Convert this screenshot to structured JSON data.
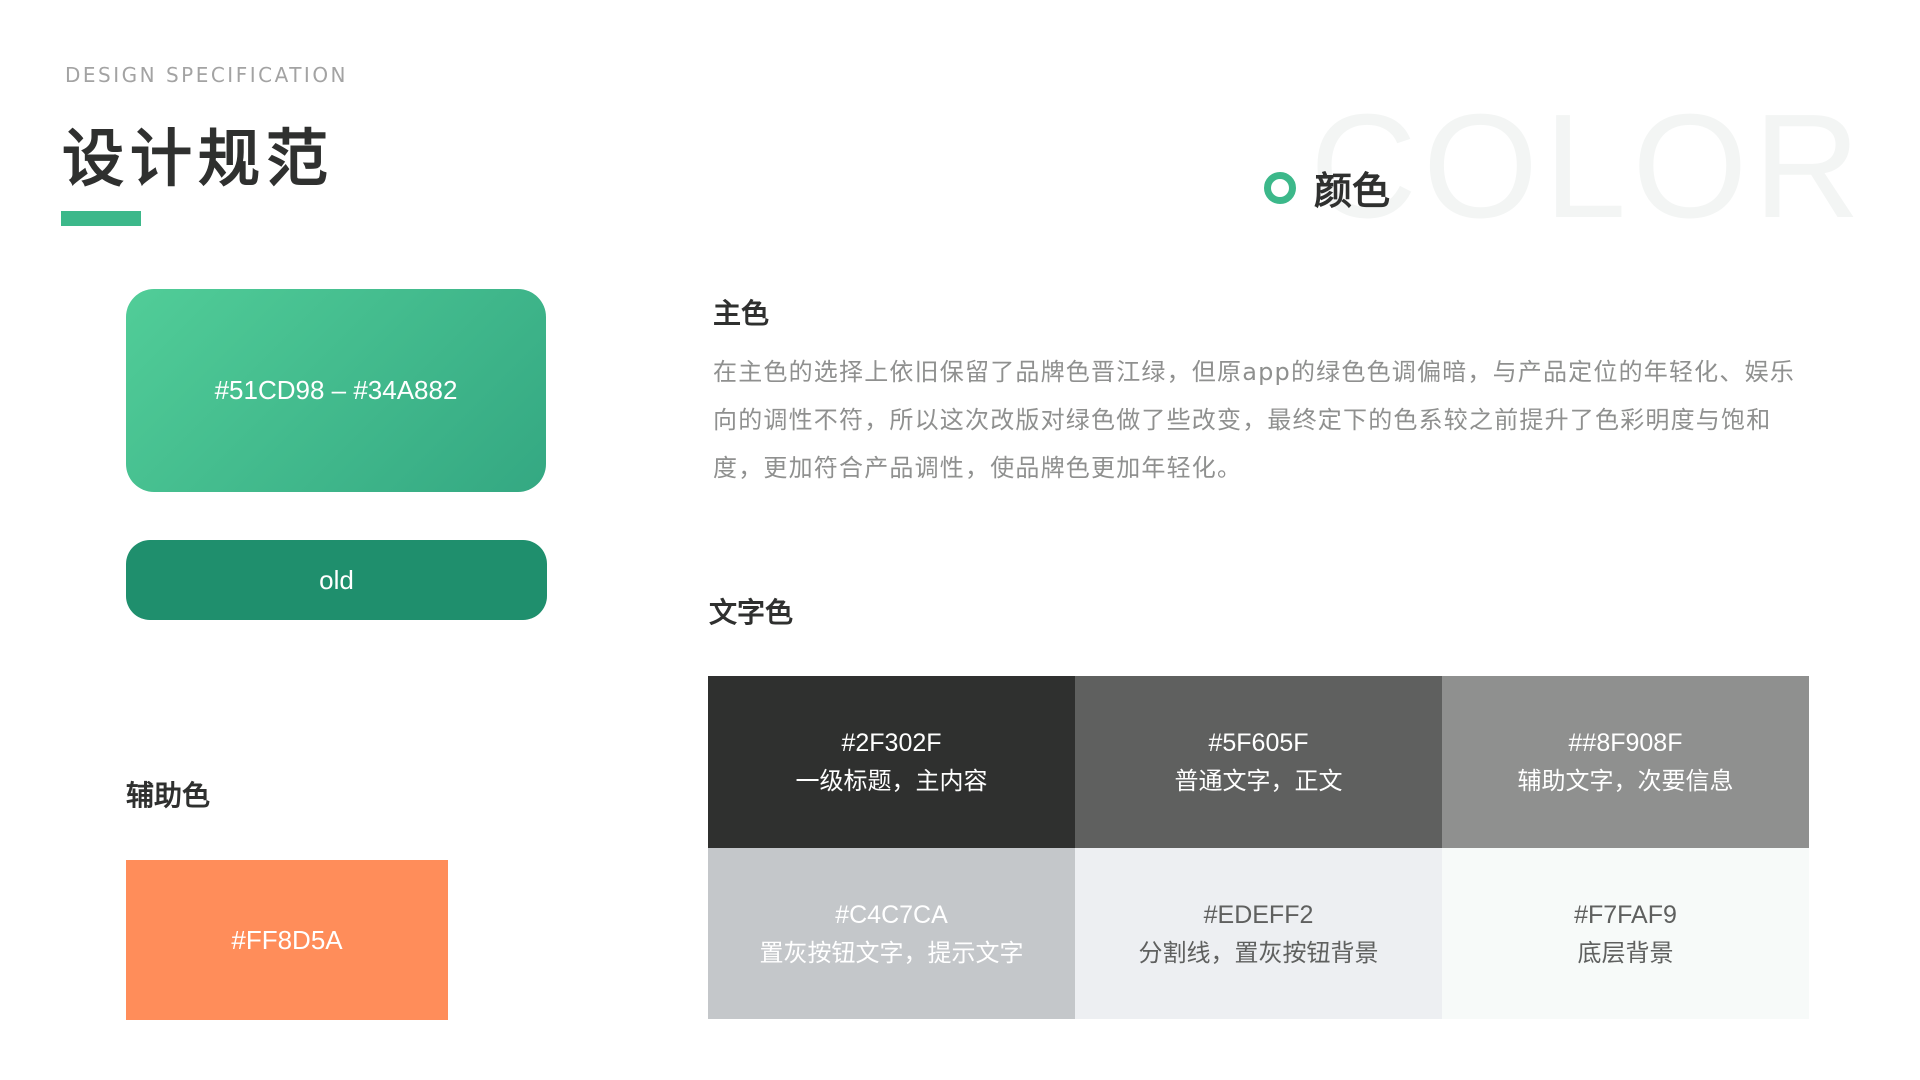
{
  "header": {
    "eyebrow": "DESIGN SPECIFICATION",
    "title": "设计规范",
    "watermark": "COLOR",
    "section_title": "颜色",
    "accent_color": "#3CB88A"
  },
  "primary": {
    "swatch_label": "#51CD98  –  #34A882",
    "gradient_from": "#51CD98",
    "gradient_to": "#34A882",
    "old_label": "old",
    "old_color": "#1F8F6D",
    "heading": "主色",
    "description": "在主色的选择上依旧保留了品牌色晋江绿，但原app的绿色色调偏暗，与产品定位的年轻化、娱乐向的调性不符，所以这次改版对绿色做了些改变，最终定下的色系较之前提升了色彩明度与饱和度，更加符合产品调性，使品牌色更加年轻化。"
  },
  "auxiliary": {
    "heading": "辅助色",
    "swatch_label": "#FF8D5A",
    "color": "#FF8D5A"
  },
  "text_colors": {
    "heading": "文字色",
    "cells": [
      {
        "hex": "#2F302F",
        "desc": "一级标题，主内容",
        "bg": "#2F302F",
        "fg": "#ffffff"
      },
      {
        "hex": "#5F605F",
        "desc": "普通文字，正文",
        "bg": "#5F605F",
        "fg": "#ffffff"
      },
      {
        "hex": "##8F908F",
        "desc": "辅助文字，次要信息",
        "bg": "#8F908F",
        "fg": "#ffffff"
      },
      {
        "hex": "#C4C7CA",
        "desc": "置灰按钮文字，提示文字",
        "bg": "#C4C7CA",
        "fg": "#ffffff"
      },
      {
        "hex": "#EDEFF2",
        "desc": "分割线，置灰按钮背景",
        "bg": "#EDEFF2",
        "fg": "#5F605F"
      },
      {
        "hex": "#F7FAF9",
        "desc": "底层背景",
        "bg": "#F7FAF9",
        "fg": "#5F605F"
      }
    ]
  }
}
